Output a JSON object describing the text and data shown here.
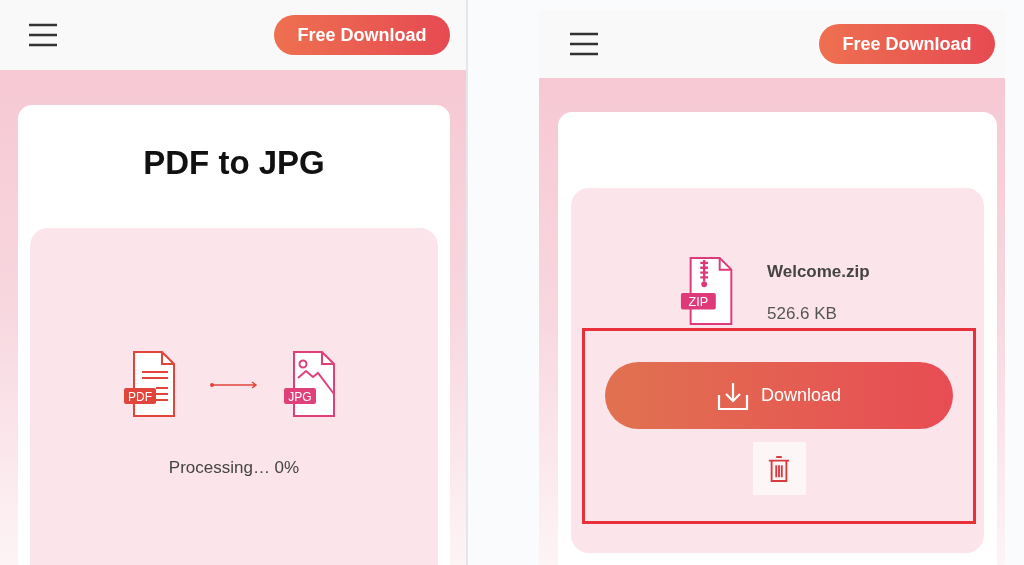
{
  "screens": [
    {
      "kind": "converting",
      "header": {
        "button": "Free Download"
      },
      "title": "PDF to JPG",
      "source_badge": "PDF",
      "target_badge": "JPG",
      "status": "Processing… 0%"
    },
    {
      "kind": "result",
      "header": {
        "button": "Free Download"
      },
      "file_badge": "ZIP",
      "file_name": "Welcome.zip",
      "file_size": "526.6 KB",
      "download_label": "Download",
      "highlighted": true
    }
  ]
}
